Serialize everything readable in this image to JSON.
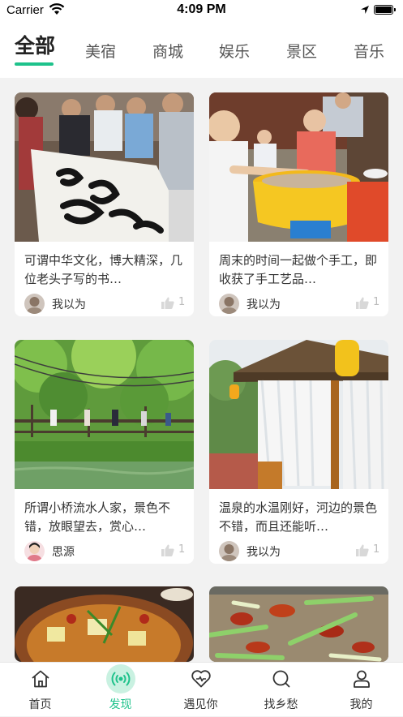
{
  "status_bar": {
    "carrier": "Carrier",
    "time": "4:09 PM"
  },
  "tabs": [
    {
      "label": "全部",
      "active": true
    },
    {
      "label": "美宿",
      "active": false
    },
    {
      "label": "商城",
      "active": false
    },
    {
      "label": "娱乐",
      "active": false
    },
    {
      "label": "景区",
      "active": false
    },
    {
      "label": "音乐",
      "active": false
    }
  ],
  "cards": [
    {
      "title": "可谓中华文化，博大精深，几位老头子写的书…",
      "author": "我以为",
      "likes": "1",
      "image": "calligraphy-photo"
    },
    {
      "title": "周末的时间一起做个手工，即收获了手工艺品…",
      "author": "我以为",
      "likes": "1",
      "image": "pottery-photo"
    },
    {
      "title": "所谓小桥流水人家，景色不错，放眼望去，赏心…",
      "author": "思源",
      "likes": "1",
      "image": "bridge-photo"
    },
    {
      "title": "温泉的水温刚好，河边的景色不错，而且还能听…",
      "author": "我以为",
      "likes": "1",
      "image": "pavilion-photo"
    },
    {
      "image": "hotpot-photo"
    },
    {
      "image": "crayfish-photo"
    }
  ],
  "tabbar": [
    {
      "label": "首页",
      "icon": "home-icon",
      "active": false
    },
    {
      "label": "发现",
      "icon": "discover-icon",
      "active": true
    },
    {
      "label": "遇见你",
      "icon": "heart-icon",
      "active": false
    },
    {
      "label": "找乡愁",
      "icon": "search-icon",
      "active": false
    },
    {
      "label": "我的",
      "icon": "profile-icon",
      "active": false
    }
  ],
  "colors": {
    "accent": "#1ec28b",
    "background": "#f2f2f2"
  }
}
